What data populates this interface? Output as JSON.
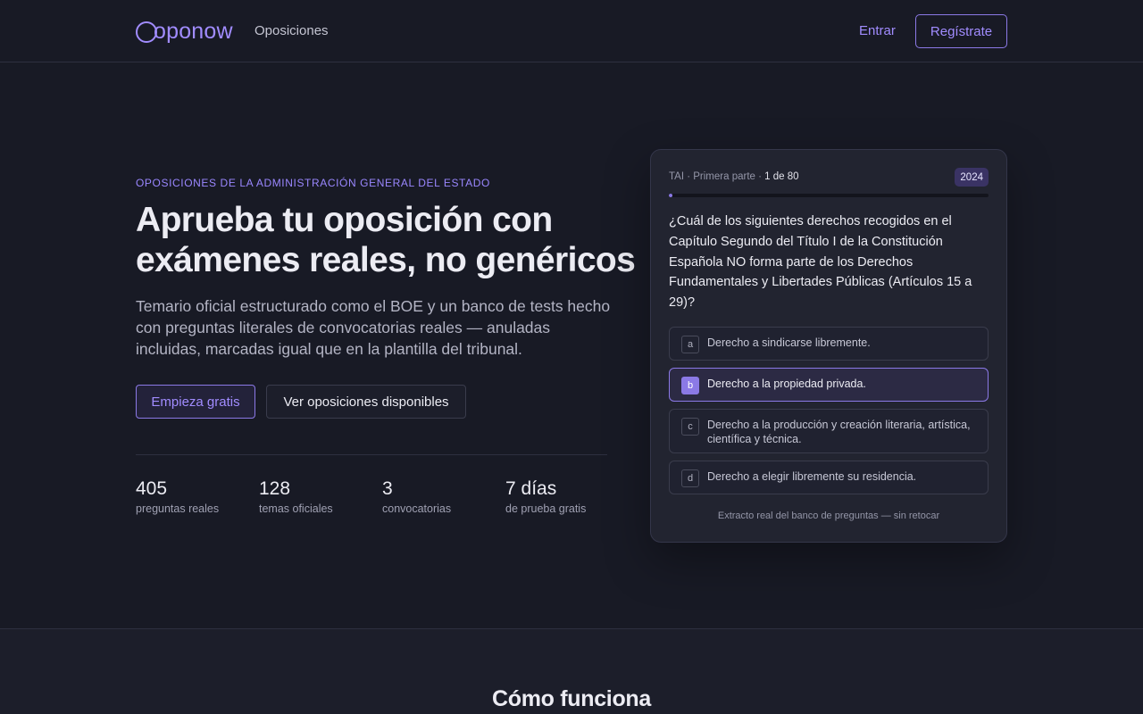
{
  "nav": {
    "logo": "oponow",
    "links": [
      "Oposiciones"
    ],
    "login_label": "Entrar",
    "signup_label": "Regístrate"
  },
  "hero": {
    "eyebrow": "Oposiciones de la Administración General del Estado",
    "title": "Aprueba tu oposición con exámenes reales, no genéricos",
    "subtitle": "Temario oficial estructurado como el BOE y un banco de tests hecho con preguntas literales de convocatorias reales — anuladas incluidas, marcadas igual que en la plantilla del tribunal.",
    "primary_cta": "Empieza gratis",
    "secondary_cta": "Ver oposiciones disponibles",
    "stats": [
      {
        "value": "405",
        "label": "preguntas reales"
      },
      {
        "value": "128",
        "label": "temas oficiales"
      },
      {
        "value": "3",
        "label": "convocatorias"
      },
      {
        "value": "7 días",
        "label": "de prueba gratis"
      }
    ]
  },
  "sample_card": {
    "meta": "TAI · Primera parte · ",
    "position": "1 de 80",
    "progress_fraction": 0.0125,
    "year": "2024",
    "question": "¿Cuál de los siguientes derechos recogidos en el Capítulo Segundo del Título I de la Constitución Española NO forma parte de los Derechos Fundamentales y Libertades Públicas (Artículos 15 a 29)?",
    "options": [
      {
        "key": "a",
        "text": "Derecho a sindicarse libremente.",
        "selected": false
      },
      {
        "key": "b",
        "text": "Derecho a la propiedad privada.",
        "selected": true
      },
      {
        "key": "c",
        "text": "Derecho a la producción y creación literaria, artística, científica y técnica.",
        "selected": false
      },
      {
        "key": "d",
        "text": "Derecho a elegir libremente su residencia.",
        "selected": false
      }
    ],
    "footnote": "Extracto real del banco de preguntas — sin retocar"
  },
  "how_it_works": {
    "title": "Cómo funciona"
  },
  "colors": {
    "accent": "#a18cff",
    "background": "#181a25",
    "card": "#222430"
  }
}
